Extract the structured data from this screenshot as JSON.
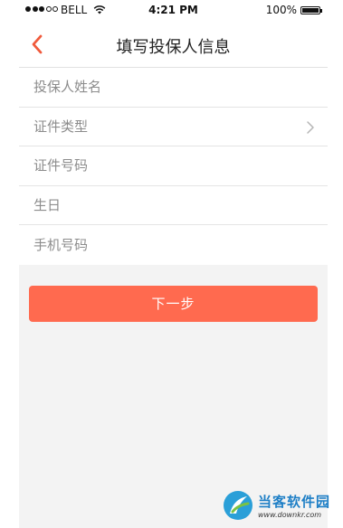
{
  "status_bar": {
    "carrier": "BELL",
    "time": "4:21 PM",
    "battery": "100%",
    "signal_bars": 3,
    "signal_total": 5
  },
  "nav": {
    "title": "填写投保人信息",
    "back_icon": "chevron-left-icon"
  },
  "form": {
    "fields": [
      {
        "placeholder": "投保人姓名",
        "value": ""
      },
      {
        "label": "证件类型",
        "icon": "chevron-right-icon"
      },
      {
        "placeholder": "证件号码",
        "value": ""
      },
      {
        "placeholder": "生日",
        "value": ""
      },
      {
        "placeholder": "手机号码",
        "value": ""
      }
    ]
  },
  "next_button": {
    "label": "下一步"
  },
  "watermark": {
    "title": "当客软件园",
    "url": "www.downkr.com"
  },
  "colors": {
    "accent": "#ff6a4f",
    "back_arrow": "#f05a3c",
    "background": "#f3f3f3"
  }
}
